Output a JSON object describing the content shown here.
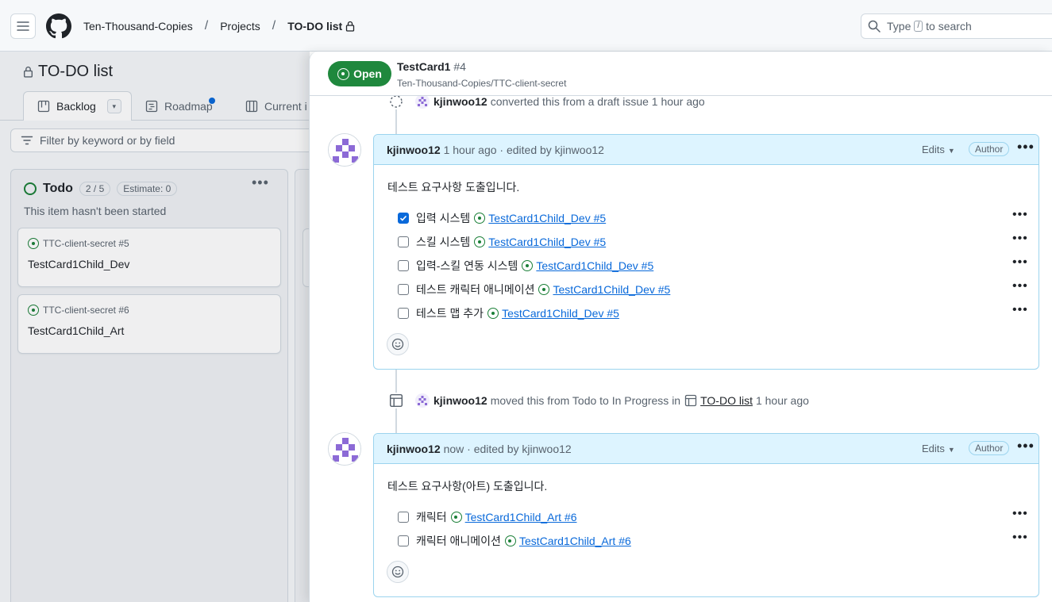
{
  "header": {
    "breadcrumbs": [
      "Ten-Thousand-Copies",
      "Projects",
      "TO-DO list"
    ],
    "search_prefix": "Type",
    "search_key": "/",
    "search_suffix": "to search"
  },
  "project": {
    "title": "TO-DO list",
    "tabs": [
      {
        "label": "Backlog"
      },
      {
        "label": "Roadmap"
      },
      {
        "label": "Current i"
      }
    ],
    "filter_placeholder": "Filter by keyword or by field",
    "column": {
      "name": "Todo",
      "count": "2 / 5",
      "estimate": "Estimate: 0",
      "description": "This item hasn't been started",
      "cards": [
        {
          "ref": "TTC-client-secret #5",
          "title": "TestCard1Child_Dev"
        },
        {
          "ref": "TTC-client-secret #6",
          "title": "TestCard1Child_Art"
        }
      ]
    }
  },
  "issue": {
    "status": "Open",
    "title": "TestCard1",
    "number": "#4",
    "repo": "Ten-Thousand-Copies/TTC-client-secret",
    "event1": {
      "user": "kjinwoo12",
      "text": "converted this from a draft issue 1 hour ago"
    },
    "comment1": {
      "user": "kjinwoo12",
      "meta": "1 hour ago · edited by kjinwoo12",
      "edits": "Edits",
      "author": "Author",
      "intro": "테스트 요구사항 도출입니다.",
      "tasks": [
        {
          "label": "입력 시스템",
          "link": "TestCard1Child_Dev #5",
          "checked": true
        },
        {
          "label": "스킬 시스템",
          "link": "TestCard1Child_Dev #5",
          "checked": false
        },
        {
          "label": "입력-스킬 연동 시스템",
          "link": "TestCard1Child_Dev #5",
          "checked": false
        },
        {
          "label": "테스트 캐릭터 애니메이션",
          "link": "TestCard1Child_Dev #5",
          "checked": false
        },
        {
          "label": "테스트 맵 추가",
          "link": "TestCard1Child_Dev #5",
          "checked": false
        }
      ]
    },
    "event2": {
      "user": "kjinwoo12",
      "text": "moved this from Todo to In Progress in",
      "project": "TO-DO list",
      "time": "1 hour ago"
    },
    "comment2": {
      "user": "kjinwoo12",
      "meta": "now · edited by kjinwoo12",
      "edits": "Edits",
      "author": "Author",
      "intro": "테스트 요구사항(아트) 도출입니다.",
      "tasks": [
        {
          "label": "캐릭터",
          "link": "TestCard1Child_Art #6",
          "checked": false
        },
        {
          "label": "캐릭터 애니메이션",
          "link": "TestCard1Child_Art #6",
          "checked": false
        }
      ]
    }
  },
  "colors": {
    "accent": "#0969da",
    "open_green": "#1f883d",
    "comment_header": "#ddf4ff"
  }
}
